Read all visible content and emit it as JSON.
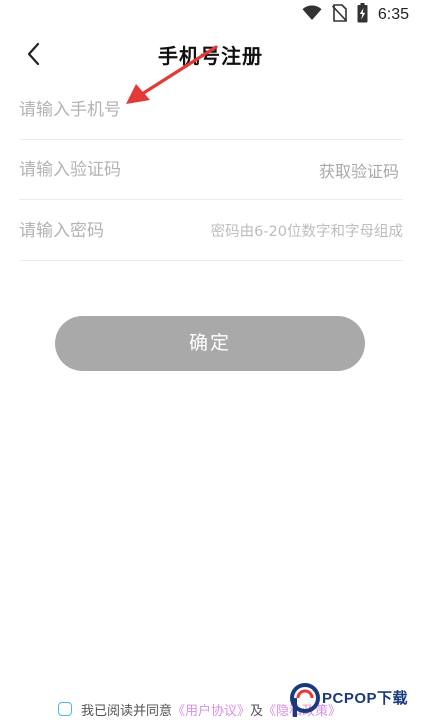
{
  "status_bar": {
    "time": "6:35",
    "icons": [
      "wifi-icon",
      "no-sim-icon",
      "battery-charging-icon"
    ]
  },
  "header": {
    "title": "手机号注册",
    "back_icon": "chevron-left-icon"
  },
  "form": {
    "phone": {
      "value": "",
      "placeholder": "请输入手机号"
    },
    "code": {
      "value": "",
      "placeholder": "请输入验证码",
      "action_label": "获取验证码"
    },
    "password": {
      "value": "",
      "placeholder": "请输入密码",
      "hint": "密码由6-20位数字和字母组成"
    }
  },
  "confirm_button": {
    "label": "确定",
    "color": "#a9a9a9"
  },
  "agreement": {
    "checked": false,
    "prefix": "我已阅读并同意",
    "user_agreement": "《用户协议》",
    "conjunction": "及",
    "privacy_policy": "《隐私政策》",
    "link_color": "#d98fe6"
  },
  "watermark": {
    "text": "PCPOP下载"
  },
  "accent_colors": {
    "annotation_arrow": "#e53935",
    "checkbox_border": "#4ab8e8"
  }
}
